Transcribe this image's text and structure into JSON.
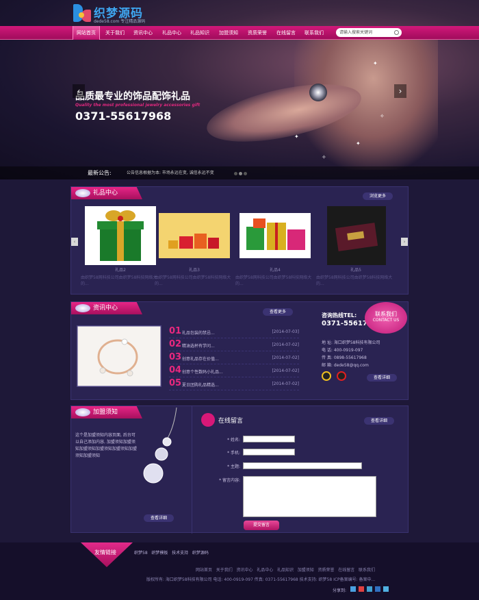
{
  "brand": {
    "name": "织梦源码",
    "url": "dede58.com",
    "slogan": "专注精品源码"
  },
  "nav": {
    "items": [
      "网站首页",
      "关于我们",
      "资讯中心",
      "礼品中心",
      "礼品知识",
      "加盟须知",
      "资质荣誉",
      "在线留言",
      "联系我们"
    ],
    "search_placeholder": "请输入搜索关键词"
  },
  "banner": {
    "title": "品质最专业的饰品配饰礼品",
    "subtitle": "Quality the most professional jewelry accessories gift",
    "phone": "0371-55617968"
  },
  "notice": {
    "label": "最新公告:",
    "text": "公告信息根据为本: 市场永远在变, 诚信永远不变"
  },
  "gifts": {
    "title": "礼品中心",
    "more": "浏览更多",
    "items": [
      {
        "name": "礼品2",
        "desc": "由织梦58网科技公司由织梦58科技网络大的..."
      },
      {
        "name": "礼品3",
        "desc": "由织梦58网科技公司由织梦58科技网络大的..."
      },
      {
        "name": "礼品4",
        "desc": "由织梦58网科技公司由织梦58科技网络大的..."
      },
      {
        "name": "礼品5",
        "desc": "由织梦58网科技公司由织梦58科技网络大的..."
      }
    ]
  },
  "news": {
    "title": "资讯中心",
    "more": "查看更多",
    "items": [
      {
        "num": "01",
        "title": "礼品包装的禁忌...",
        "date": "[2014-07-03]"
      },
      {
        "num": "02",
        "title": "精油选杯有学问...",
        "date": "[2014-07-02]"
      },
      {
        "num": "03",
        "title": "创意礼品存在价值...",
        "date": "[2014-07-02]"
      },
      {
        "num": "04",
        "title": "创意个性数码小礼品...",
        "date": "[2014-07-02]"
      },
      {
        "num": "05",
        "title": "夏日团购礼品精选...",
        "date": "[2014-07-02]"
      }
    ]
  },
  "contact": {
    "hotline": "咨询热线TEL:",
    "phone": "0371-55617968",
    "badge_cn": "联系我们",
    "badge_en": "CONTACT US",
    "address": "地  址: 海口织梦58科技有限公司",
    "tel": "电  话: 400-0919-097",
    "fax": "传  真: 0898-55617968",
    "email": "邮  箱: dede58@qq.com",
    "details": "查看详细"
  },
  "join": {
    "title": "加盟须知",
    "text": "这个是加盟须知内容页面, 后台可以自己添加内容, 加盟须知加盟须知加盟须知加盟须知加盟须知加盟须知加盟须知",
    "details": "查看详细"
  },
  "message": {
    "title": "在线留言",
    "more": "查看详细",
    "name_label": "* 姓名:",
    "phone_label": "* 手机:",
    "subject_label": "* 主题:",
    "content_label": "* 留言内容:",
    "submit": "提交留言"
  },
  "footer": {
    "links_title": "友情链接",
    "links": [
      "织梦58",
      "织梦模板",
      "技术支持",
      "织梦源码"
    ],
    "nav": [
      "网站首页",
      "关于我们",
      "资讯中心",
      "礼品中心",
      "礼品知识",
      "加盟须知",
      "资质荣誉",
      "在线留言",
      "联系我们"
    ],
    "copyright": "版权所有: 海口织梦58科技有限公司   电话: 400-0919-097   传真: 0371-55617968   技术支持: 织梦58   ICP备案编号: 备案中...",
    "share": "分享到:"
  },
  "colors": {
    "accent": "#d2187a",
    "panel": "#2a2352",
    "background": "#1e1838"
  }
}
